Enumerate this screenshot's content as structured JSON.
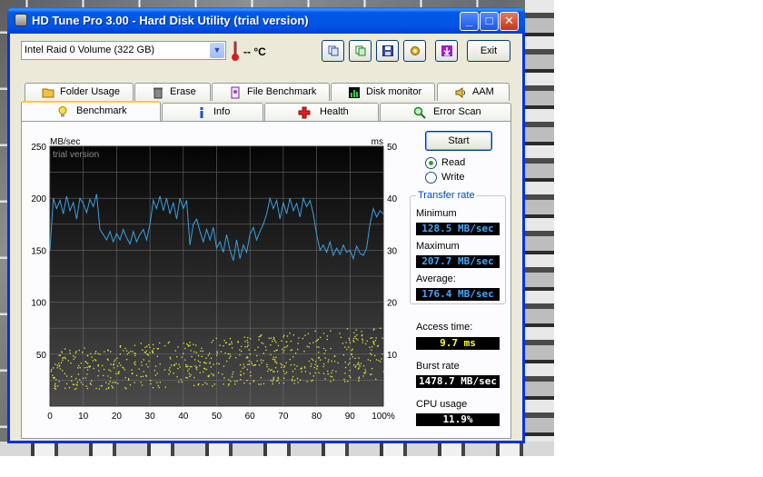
{
  "window": {
    "title": "HD Tune Pro 3.00 - Hard Disk Utility (trial version)"
  },
  "toolbar": {
    "drive": "Intel   Raid 0 Volume (322 GB)",
    "temperature": "-- °C",
    "exit_label": "Exit"
  },
  "tabs_top": [
    "Folder Usage",
    "Erase",
    "File Benchmark",
    "Disk monitor",
    "AAM"
  ],
  "tabs_bottom": [
    "Benchmark",
    "Info",
    "Health",
    "Error Scan"
  ],
  "controls": {
    "start_label": "Start",
    "read_label": "Read",
    "write_label": "Write",
    "mode": "Read"
  },
  "transfer_rate": {
    "title": "Transfer rate",
    "minimum_label": "Minimum",
    "minimum": "128.5 MB/sec",
    "maximum_label": "Maximum",
    "maximum": "207.7 MB/sec",
    "average_label": "Average:",
    "average": "176.4 MB/sec"
  },
  "access_time": {
    "label": "Access time:",
    "value": "9.7 ms"
  },
  "burst_rate": {
    "label": "Burst rate",
    "value": "1478.7 MB/sec"
  },
  "cpu_usage": {
    "label": "CPU usage",
    "value": "11.9%"
  },
  "chart_data": {
    "type": "line",
    "watermark": "trial version",
    "y_left_label": "MB/sec",
    "y_right_label": "ms",
    "y_left_ticks": [
      250,
      200,
      150,
      100,
      50
    ],
    "y_right_ticks": [
      50,
      40,
      30,
      20,
      10
    ],
    "x_ticks": [
      "0",
      "10",
      "20",
      "30",
      "40",
      "50",
      "60",
      "70",
      "80",
      "90",
      "100%"
    ],
    "ylim_left": [
      0,
      250
    ],
    "ylim_right": [
      0,
      50
    ],
    "xlim": [
      0,
      100
    ],
    "series": [
      {
        "color": "#3aa0e0",
        "axis": "left",
        "x": [
          0,
          1,
          2,
          3,
          4,
          5,
          6,
          7,
          8,
          9,
          10,
          11,
          12,
          13,
          14,
          15,
          16,
          17,
          18,
          19,
          20,
          21,
          22,
          23,
          24,
          25,
          26,
          27,
          28,
          29,
          30,
          31,
          32,
          33,
          34,
          35,
          36,
          37,
          38,
          39,
          40,
          41,
          42,
          43,
          44,
          45,
          46,
          47,
          48,
          49,
          50,
          51,
          52,
          53,
          54,
          55,
          56,
          57,
          58,
          59,
          60,
          61,
          62,
          63,
          64,
          65,
          66,
          67,
          68,
          69,
          70,
          71,
          72,
          73,
          74,
          75,
          76,
          77,
          78,
          79,
          80,
          81,
          82,
          83,
          84,
          85,
          86,
          87,
          88,
          89,
          90,
          91,
          92,
          93,
          94,
          95,
          96,
          97,
          98,
          99,
          100
        ],
        "y": [
          150,
          200,
          190,
          198,
          185,
          202,
          188,
          196,
          180,
          200,
          195,
          186,
          199,
          192,
          204,
          170,
          165,
          160,
          168,
          158,
          166,
          160,
          170,
          162,
          156,
          168,
          158,
          165,
          170,
          160,
          175,
          198,
          190,
          202,
          188,
          200,
          185,
          196,
          180,
          200,
          190,
          198,
          155,
          175,
          180,
          168,
          158,
          170,
          160,
          172,
          152,
          158,
          148,
          165,
          150,
          140,
          160,
          142,
          155,
          148,
          165,
          172,
          160,
          168,
          175,
          185,
          200,
          190,
          198,
          180,
          196,
          185,
          200,
          188,
          195,
          182,
          200,
          192,
          198,
          185,
          165,
          150,
          155,
          148,
          158,
          145,
          152,
          146,
          155,
          148,
          150,
          142,
          154,
          147,
          145,
          152,
          175,
          190,
          182,
          188,
          185
        ]
      }
    ]
  }
}
